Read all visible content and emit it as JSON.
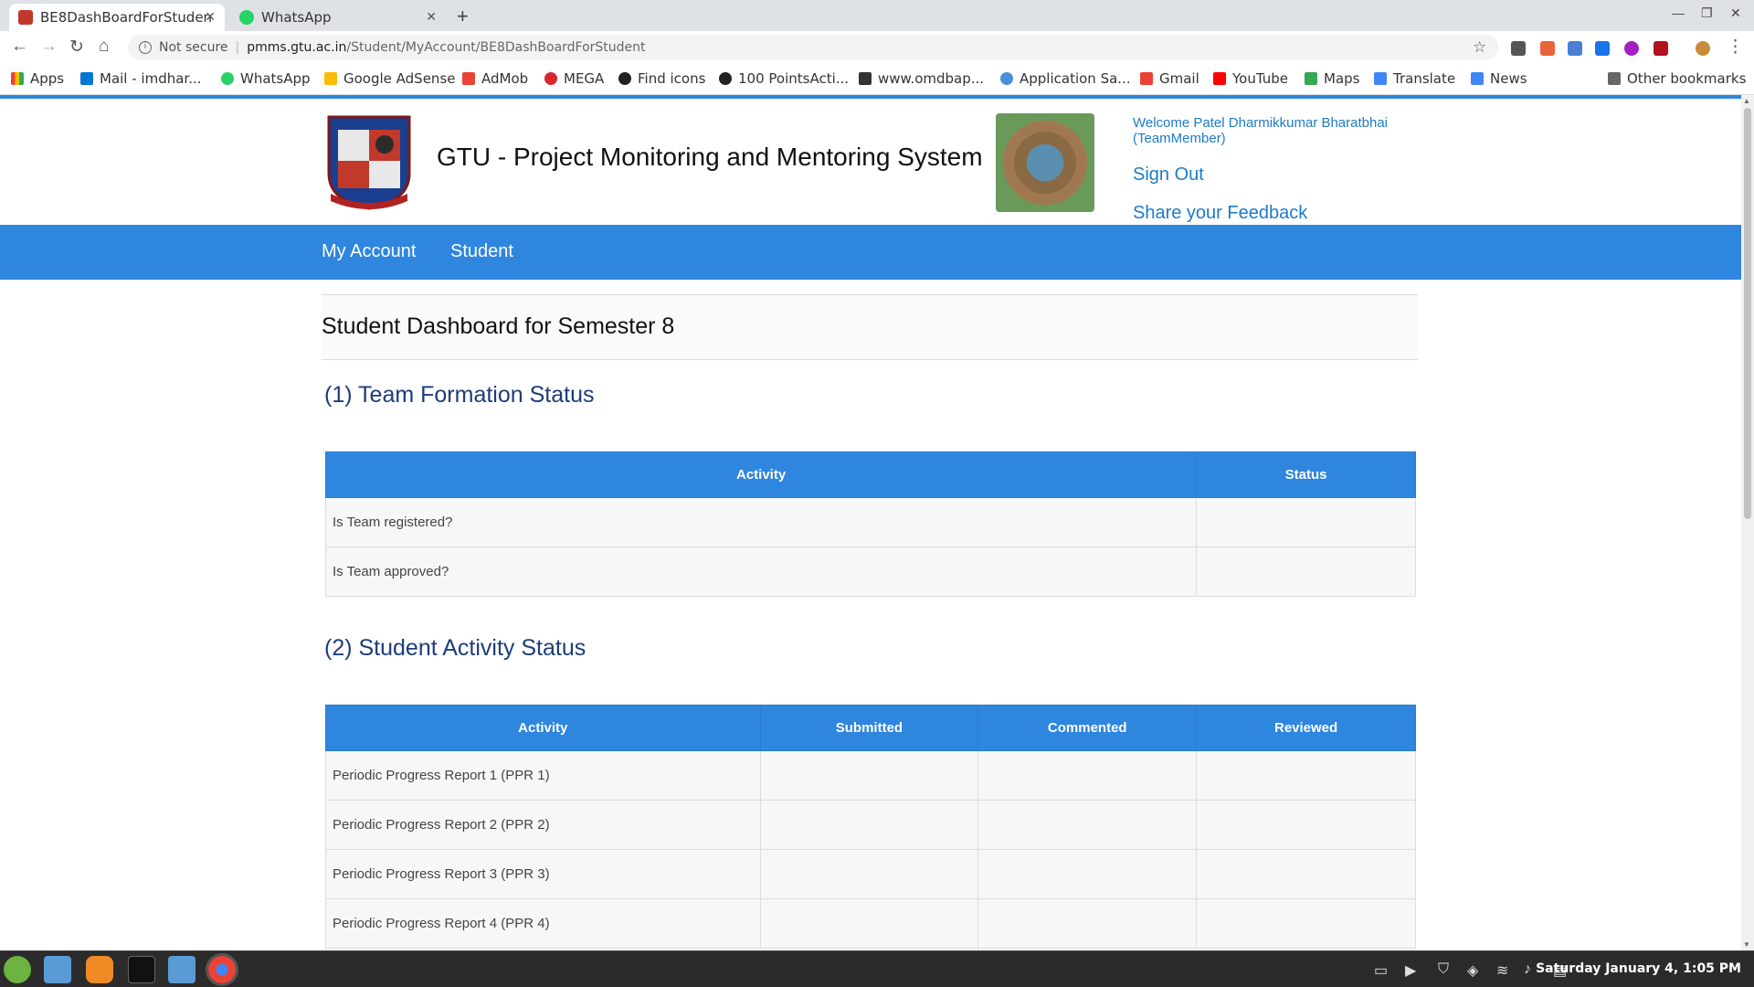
{
  "browser": {
    "tabs": [
      {
        "title": "BE8DashBoardForStuden",
        "active": true
      },
      {
        "title": "WhatsApp",
        "active": false
      }
    ],
    "url": {
      "security": "Not secure",
      "host": "pmms.gtu.ac.in",
      "path": "/Student/MyAccount/BE8DashBoardForStudent"
    },
    "bookmarks": [
      "Apps",
      "Mail - imdhar...",
      "WhatsApp",
      "Google AdSense",
      "AdMob",
      "MEGA",
      "Find icons",
      "100 PointsActi...",
      "www.omdbap...",
      "Application Sa...",
      "Gmail",
      "YouTube",
      "Maps",
      "Translate",
      "News"
    ],
    "other_bookmarks": "Other bookmarks"
  },
  "header": {
    "title": "GTU - Project Monitoring and Mentoring System",
    "welcome": "Welcome Patel Dharmikkumar Bharatbhai (TeamMember)",
    "sign_out": "Sign Out",
    "feedback": "Share your Feedback"
  },
  "menu": [
    "My Account",
    "Student"
  ],
  "dashboard_title": "Student Dashboard for Semester 8",
  "team_section": {
    "title": "(1) Team Formation Status",
    "columns": [
      "Activity",
      "Status"
    ],
    "rows": [
      "Is Team registered?",
      "Is Team approved?"
    ]
  },
  "activity_section": {
    "title": "(2) Student Activity Status",
    "columns": [
      "Activity",
      "Submitted",
      "Commented",
      "Reviewed"
    ],
    "rows": [
      "Periodic Progress Report 1 (PPR 1)",
      "Periodic Progress Report 2 (PPR 2)",
      "Periodic Progress Report 3 (PPR 3)",
      "Periodic Progress Report 4 (PPR 4)"
    ]
  },
  "taskbar": {
    "clock": "Saturday January 4, 1:05 PM"
  },
  "colors": {
    "brand_blue": "#2e86de",
    "section_title": "#1d3c78",
    "link": "#1e7bc8"
  }
}
